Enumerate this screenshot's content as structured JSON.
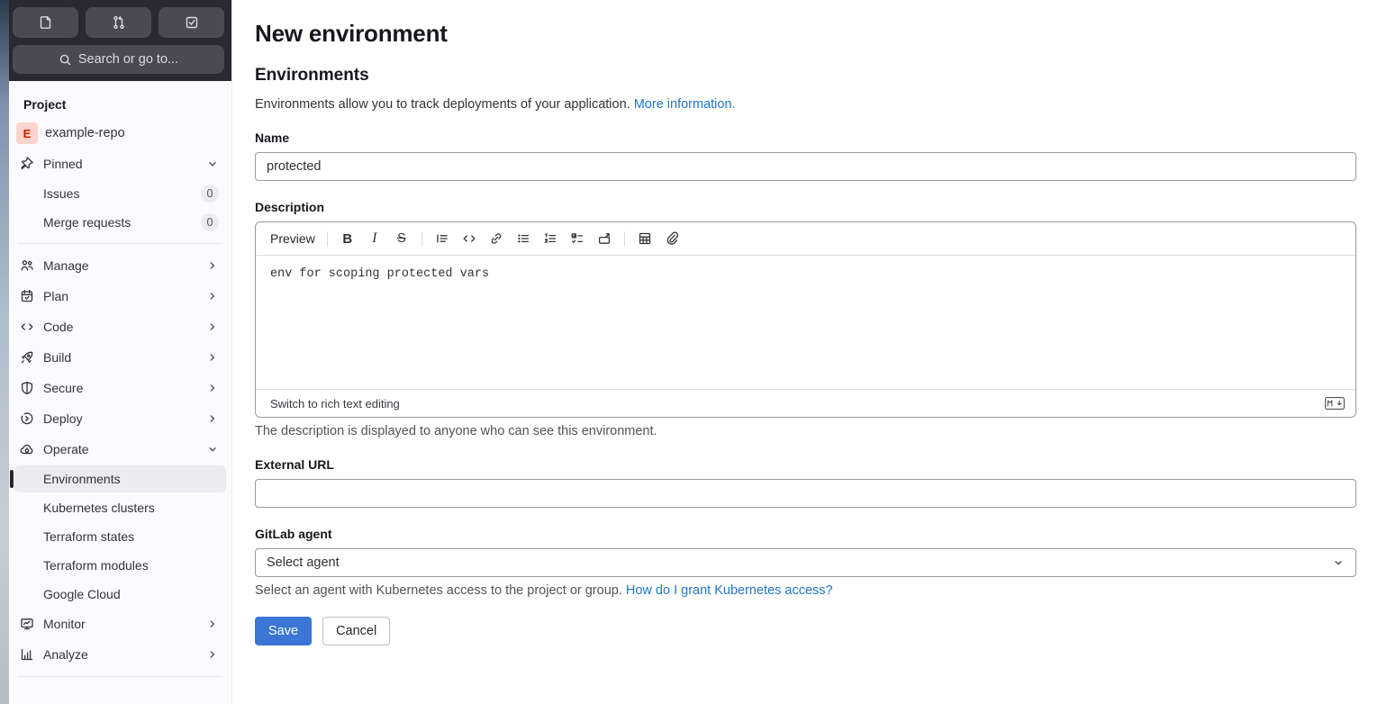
{
  "colors": {
    "accent_blue": "#3b76d4",
    "link_blue": "#1f75cb",
    "sidebar_header_bg": "#2a2931",
    "active_item_bg": "#ececef",
    "avatar_bg": "#fdd4cd",
    "avatar_text": "#c91c00"
  },
  "sidebar": {
    "header_icons": [
      "issues-icon",
      "merge-request-icon",
      "todo-list-icon"
    ],
    "search": {
      "placeholder": "Search or go to...",
      "icon": "search-icon"
    },
    "section_label": "Project",
    "project": {
      "avatar_letter": "E",
      "name": "example-repo"
    },
    "pinned": {
      "label": "Pinned",
      "icon": "pin-icon",
      "state": "expanded"
    },
    "pinned_items": [
      {
        "label": "Issues",
        "badge": "0"
      },
      {
        "label": "Merge requests",
        "badge": "0"
      }
    ],
    "nav": [
      {
        "label": "Manage",
        "icon": "users-icon",
        "chevron": "right"
      },
      {
        "label": "Plan",
        "icon": "calendar-icon",
        "chevron": "right"
      },
      {
        "label": "Code",
        "icon": "code-icon",
        "chevron": "right"
      },
      {
        "label": "Build",
        "icon": "rocket-icon",
        "chevron": "right"
      },
      {
        "label": "Secure",
        "icon": "shield-icon",
        "chevron": "right"
      },
      {
        "label": "Deploy",
        "icon": "deploy-icon",
        "chevron": "right"
      },
      {
        "label": "Operate",
        "icon": "cloud-pod-icon",
        "chevron": "down"
      },
      {
        "label": "Monitor",
        "icon": "monitor-icon",
        "chevron": "right"
      },
      {
        "label": "Analyze",
        "icon": "chart-icon",
        "chevron": "right"
      }
    ],
    "operate_children": [
      {
        "label": "Environments",
        "active": true
      },
      {
        "label": "Kubernetes clusters",
        "active": false
      },
      {
        "label": "Terraform states",
        "active": false
      },
      {
        "label": "Terraform modules",
        "active": false
      },
      {
        "label": "Google Cloud",
        "active": false
      }
    ]
  },
  "main": {
    "title": "New environment",
    "section_title": "Environments",
    "intro_text": "Environments allow you to track deployments of your application.",
    "intro_link": "More information.",
    "name": {
      "label": "Name",
      "value": "protected"
    },
    "description": {
      "label": "Description",
      "preview_label": "Preview",
      "toolbar_icons": [
        "bold",
        "italic",
        "strikethrough",
        "quote",
        "code",
        "link",
        "bullet-list",
        "numbered-list",
        "task-list",
        "collapsible-section",
        "table",
        "attach-file"
      ],
      "value": "env for scoping protected vars",
      "switch_label": "Switch to rich text editing",
      "markdown_icon": "markdown-mark-icon",
      "help": "The description is displayed to anyone who can see this environment."
    },
    "external_url": {
      "label": "External URL",
      "value": ""
    },
    "agent": {
      "label": "GitLab agent",
      "value": "Select agent",
      "help": "Select an agent with Kubernetes access to the project or group.",
      "help_link": "How do I grant Kubernetes access?"
    },
    "buttons": {
      "save": "Save",
      "cancel": "Cancel"
    }
  }
}
